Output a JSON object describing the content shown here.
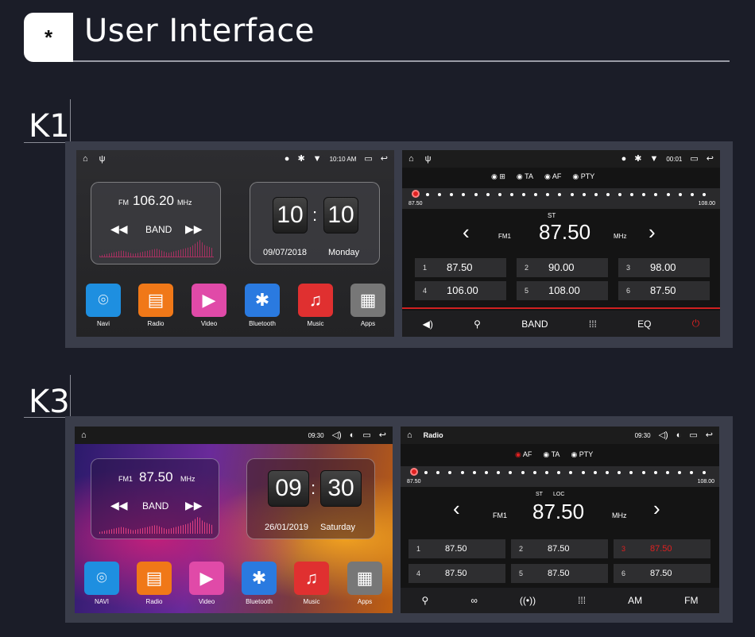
{
  "header": {
    "badge": "*",
    "title": "User Interface"
  },
  "sections": {
    "k1": "K1",
    "k3": "K3"
  },
  "k1_home": {
    "time": "10:10 AM",
    "radio_widget": {
      "band_label": "FM",
      "freq": "106.20",
      "unit": "MHz",
      "band_btn": "BAND"
    },
    "clock": {
      "hour": "10",
      "sep": ":",
      "minute": "10",
      "date": "09/07/2018",
      "day": "Monday"
    },
    "apps": [
      "Navi",
      "Radio",
      "Video",
      "Bluetooth",
      "Music",
      "Apps"
    ]
  },
  "k1_radio": {
    "time": "00:01",
    "options": [
      "TA",
      "AF",
      "PTY"
    ],
    "scale_min": "87.50",
    "scale_max": "108.00",
    "stereo": "ST",
    "band": "FM1",
    "freq": "87.50",
    "unit": "MHz",
    "presets": [
      {
        "n": "1",
        "v": "87.50"
      },
      {
        "n": "2",
        "v": "90.00"
      },
      {
        "n": "3",
        "v": "98.00"
      },
      {
        "n": "4",
        "v": "106.00"
      },
      {
        "n": "5",
        "v": "108.00"
      },
      {
        "n": "6",
        "v": "87.50"
      }
    ],
    "bottom": {
      "band": "BAND",
      "eq": "EQ"
    }
  },
  "k3_home": {
    "time": "09:30",
    "radio_widget": {
      "band_label": "FM1",
      "freq": "87.50",
      "unit": "MHz",
      "band_btn": "BAND"
    },
    "clock": {
      "hour": "09",
      "sep": ":",
      "minute": "30",
      "date": "26/01/2019",
      "day": "Saturday"
    },
    "apps": [
      "NAVI",
      "Radio",
      "Video",
      "Bluetooth",
      "Music",
      "Apps"
    ]
  },
  "k3_radio": {
    "title": "Radio",
    "time": "09:30",
    "options": [
      "AF",
      "TA",
      "PTY"
    ],
    "scale_min": "87.50",
    "scale_max": "108.00",
    "stereo": "ST",
    "loc": "LOC",
    "band": "FM1",
    "freq": "87.50",
    "unit": "MHz",
    "presets": [
      {
        "n": "1",
        "v": "87.50"
      },
      {
        "n": "2",
        "v": "87.50"
      },
      {
        "n": "3",
        "v": "87.50"
      },
      {
        "n": "4",
        "v": "87.50"
      },
      {
        "n": "5",
        "v": "87.50"
      },
      {
        "n": "6",
        "v": "87.50"
      }
    ],
    "bottom": {
      "am": "AM",
      "fm": "FM"
    }
  },
  "colors": {
    "accent_red": "#e02020",
    "bg": "#1b1d28",
    "frame": "#3a3d4a"
  }
}
